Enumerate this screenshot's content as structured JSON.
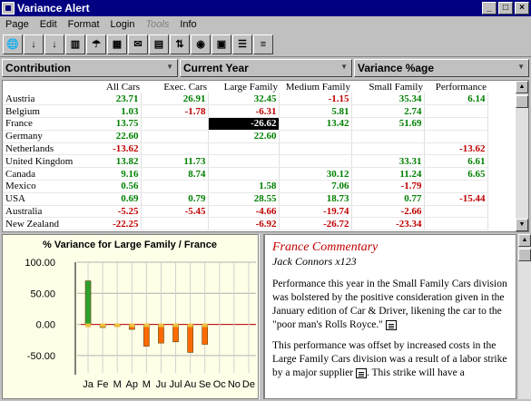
{
  "window": {
    "title": "Variance Alert",
    "min": "_",
    "max": "□",
    "close": "×"
  },
  "menu": [
    "Page",
    "Edit",
    "Format",
    "Login",
    "Tools",
    "Info"
  ],
  "toolbar": [
    {
      "name": "globe-icon",
      "glyph": "🌐"
    },
    {
      "name": "sort-ascending-icon",
      "glyph": "↓"
    },
    {
      "name": "sort-descending-icon",
      "glyph": "↓"
    },
    {
      "name": "books-icon",
      "glyph": "▥"
    },
    {
      "name": "umbrella-icon",
      "glyph": "☂"
    },
    {
      "name": "chart-icon",
      "glyph": "▦"
    },
    {
      "name": "envelope-icon",
      "glyph": "✉"
    },
    {
      "name": "grid-icon",
      "glyph": "▤"
    },
    {
      "name": "signpost-icon",
      "glyph": "⇅"
    },
    {
      "name": "eye-icon",
      "glyph": "◉"
    },
    {
      "name": "disk-icon",
      "glyph": "▣"
    },
    {
      "name": "tree-icon",
      "glyph": "☰"
    },
    {
      "name": "list-icon",
      "glyph": "≡"
    }
  ],
  "selectors": {
    "contribution": "Contribution",
    "period": "Current Year",
    "measure": "Variance %age"
  },
  "grid": {
    "columns": [
      "All Cars",
      "Exec. Cars",
      "Large Family",
      "Medium Family",
      "Small Family",
      "Performance"
    ],
    "rows": [
      {
        "country": "Austria",
        "values": [
          "23.71",
          "26.91",
          "32.45",
          "-1.15",
          "35.34",
          "6.14"
        ]
      },
      {
        "country": "Belgium",
        "values": [
          "1.03",
          "-1.78",
          "-6.31",
          "5.81",
          "2.74",
          ""
        ]
      },
      {
        "country": "France",
        "values": [
          "13.75",
          "",
          "-26.62",
          "13.42",
          "51.69",
          ""
        ]
      },
      {
        "country": "Germany",
        "values": [
          "22.60",
          "",
          "22.60",
          "",
          "",
          ""
        ]
      },
      {
        "country": "Netherlands",
        "values": [
          "-13.62",
          "",
          "",
          "",
          "",
          "-13.62"
        ]
      },
      {
        "country": "United Kingdom",
        "values": [
          "13.82",
          "11.73",
          "",
          "",
          "33.31",
          "6.61"
        ]
      },
      {
        "country": "Canada",
        "values": [
          "9.16",
          "8.74",
          "",
          "30.12",
          "11.24",
          "6.65"
        ]
      },
      {
        "country": "Mexico",
        "values": [
          "0.56",
          "",
          "1.58",
          "7.06",
          "-1.79",
          ""
        ]
      },
      {
        "country": "USA",
        "values": [
          "0.69",
          "0.79",
          "28.55",
          "18.73",
          "0.77",
          "-15.44"
        ]
      },
      {
        "country": "Australia",
        "values": [
          "-5.25",
          "-5.45",
          "-4.66",
          "-19.74",
          "-2.66",
          ""
        ]
      },
      {
        "country": "New Zealand",
        "values": [
          "-22.25",
          "",
          "-6.92",
          "-26.72",
          "-23.34",
          ""
        ]
      }
    ]
  },
  "chart_data": {
    "type": "bar",
    "title": "% Variance for Large Family / France",
    "categories": [
      "Ja",
      "Fe",
      "M",
      "Ap",
      "M",
      "Ju",
      "Jul",
      "Au",
      "Se",
      "Oc",
      "No",
      "De"
    ],
    "values": [
      70,
      -5,
      -3,
      -8,
      -35,
      -30,
      -28,
      -45,
      -32,
      0,
      0,
      0
    ],
    "ylim": [
      -75,
      100
    ],
    "yticks": [
      "100.00",
      "50.00",
      "0.00",
      "-50.00"
    ],
    "ytick_values": [
      100,
      50,
      0,
      -50
    ],
    "colors": {
      "positive": "#2ea02e",
      "negative": "#e07818",
      "negative_fill": "#ff6a00"
    }
  },
  "commentary": {
    "title": "France Commentary",
    "author": "Jack Connors x123",
    "para1": "Performance this year in the Small Family Cars division was bolstered by the positive consideration given in the January edition of Car & Driver, likening the car to the \"poor man's Rolls Royce.\"",
    "para2": "This performance was offset by increased costs in the Large Family Cars division was a result of a labor strike by a major supplier",
    "para2b": "This strike will have a"
  }
}
